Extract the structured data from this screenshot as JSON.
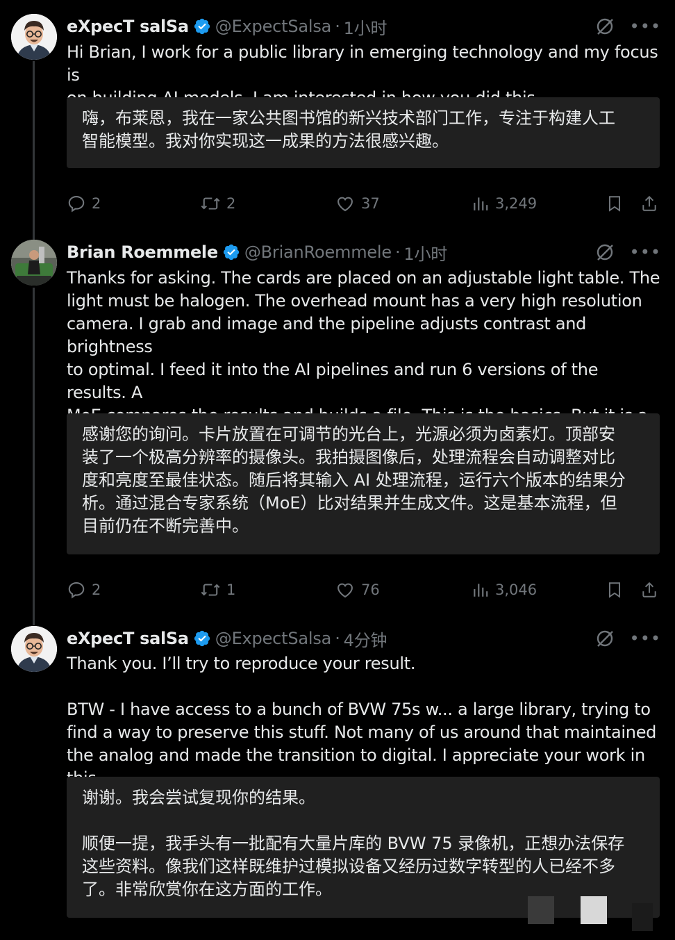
{
  "tweets": [
    {
      "name": "eXpecT salSa",
      "handle": "@ExpectSalsa",
      "time": "1小时",
      "text": "Hi Brian,  I work for a public library in emerging technology and my focus is\non building AI models.  I am interested in how you did this.",
      "translation": "嗨，布莱恩，我在一家公共图书馆的新兴技术部门工作，专注于构建人工\n智能模型。我对你实现这一成果的方法很感兴趣。",
      "replies": "2",
      "reposts": "2",
      "likes": "37",
      "views": "3,249"
    },
    {
      "name": "Brian Roemmele",
      "handle": "@BrianRoemmele",
      "time": "1小时",
      "text": "Thanks for asking. The cards are placed on an adjustable light table. The\nlight must be halogen. The overhead mount has a very high resolution\ncamera. I grab and image and the pipeline adjusts contrast and brightness\nto optimal. I feed it into the AI pipelines and run 6 versions of the results. A\nMoE compares the results and builds a file. This is the basics. But it is a\nwork in progress.",
      "translation": "感谢您的询问。卡片放置在可调节的光台上，光源必须为卤素灯。顶部安\n装了一个极高分辨率的摄像头。我拍摄图像后，处理流程会自动调整对比\n度和亮度至最佳状态。随后将其输入 AI 处理流程，运行六个版本的结果分\n析。通过混合专家系统（MoE）比对结果并生成文件。这是基本流程，但\n目前仍在不断完善中。",
      "replies": "2",
      "reposts": "1",
      "likes": "76",
      "views": "3,046"
    },
    {
      "name": "eXpecT salSa",
      "handle": "@ExpectSalsa",
      "time": "4分钟",
      "text": "Thank you.  I’ll try to reproduce your result.\n\nBTW - I have access to a bunch of BVW 75s w... a large library,  trying to\nfind a way to preserve this stuff.  Not many of us around that maintained\nthe analog and made the transition to digital.  I appreciate your work in this.",
      "translation": "谢谢。我会尝试复现你的结果。\n\n顺便一提，我手头有一批配有大量片库的 BVW 75 录像机，正想办法保存\n这些资料。像我们这样既维护过模拟设备又经历过数字转型的人已经不多\n了。非常欣赏你在这方面的工作。"
    }
  ],
  "icons": {
    "verified": "verified-badge-icon",
    "grok": "grok-icon",
    "more": "more-icon",
    "reply": "reply-icon",
    "repost": "repost-icon",
    "like": "heart-icon",
    "views": "views-icon",
    "bookmark": "bookmark-icon",
    "share": "share-icon"
  },
  "more_glyph": "•••",
  "dot": "·",
  "colors": {
    "background": "#000000",
    "text": "#e7e9ea",
    "muted": "#71767b",
    "verified": "#1d9bf0",
    "translation_box": "#202020"
  }
}
